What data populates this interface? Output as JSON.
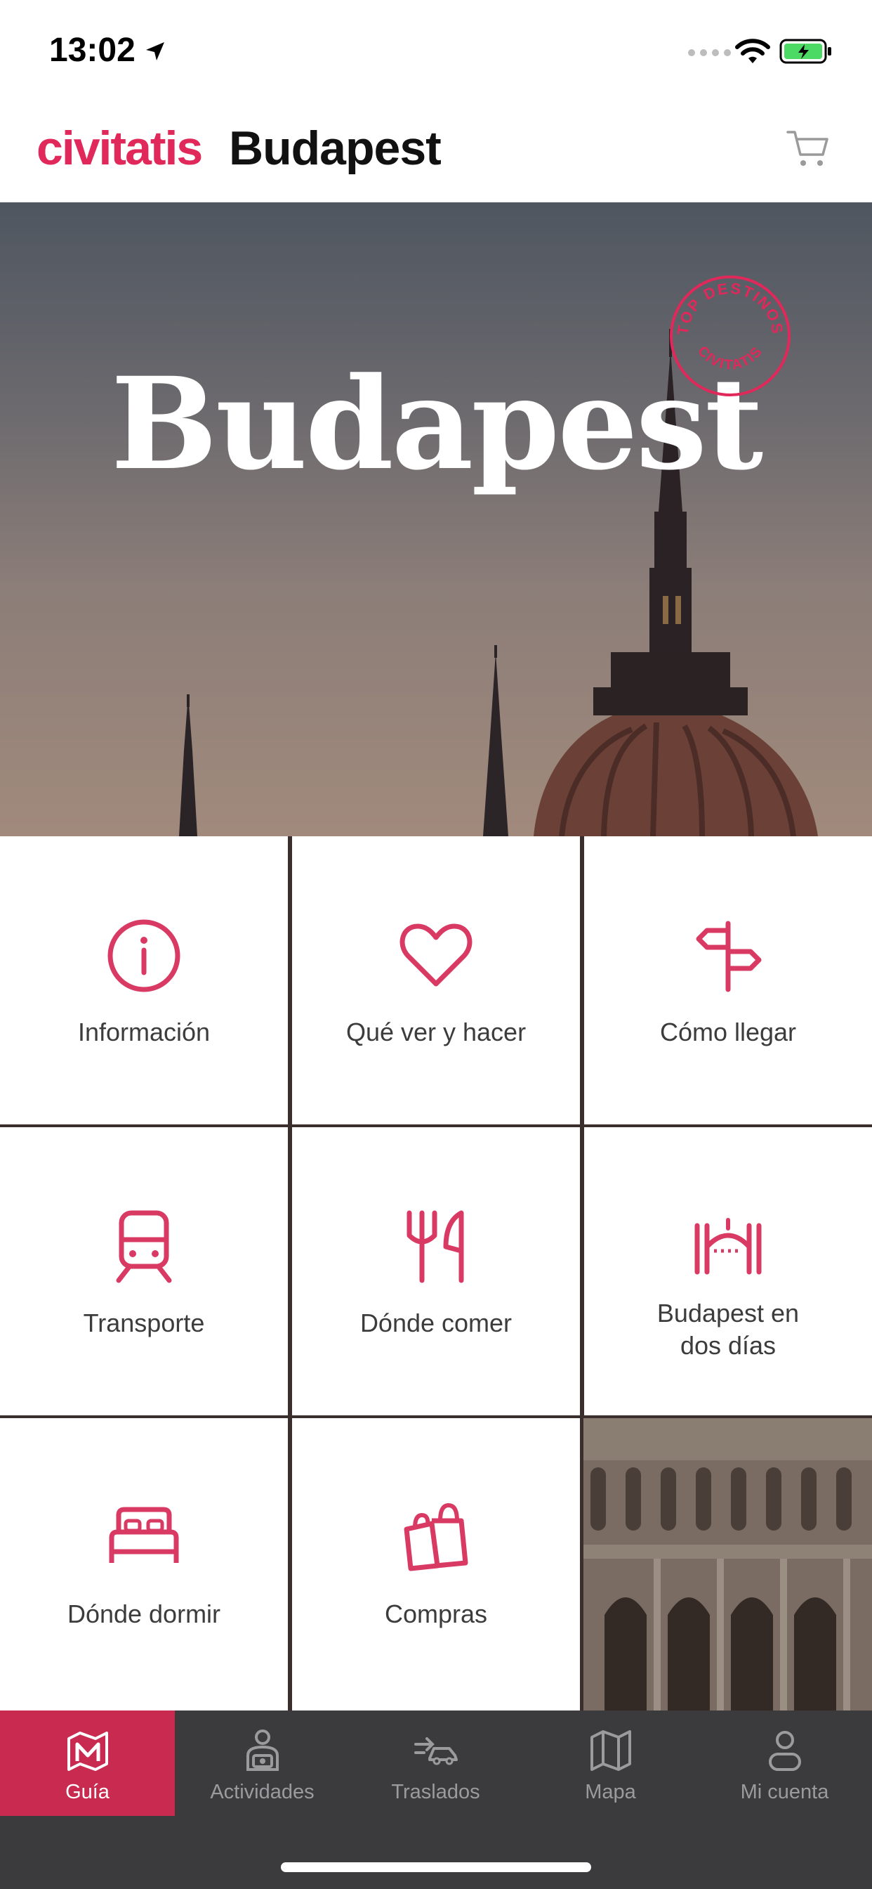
{
  "status_bar": {
    "time": "13:02"
  },
  "header": {
    "brand": "civitatis",
    "title": "Budapest"
  },
  "hero": {
    "title": "Budapest",
    "stamp_top": "TOP DESTINOS",
    "stamp_bottom": "CIVITATIS"
  },
  "grid": {
    "items": [
      {
        "label": "Información",
        "icon": "info-icon"
      },
      {
        "label": "Qué ver y hacer",
        "icon": "heart-icon"
      },
      {
        "label": "Cómo llegar",
        "icon": "signpost-icon"
      },
      {
        "label": "Transporte",
        "icon": "train-icon"
      },
      {
        "label": "Dónde comer",
        "icon": "fork-knife-icon"
      },
      {
        "label": "Budapest en dos días",
        "label_line1": "Budapest en",
        "label_line2": "dos días",
        "icon": "arch-icon"
      },
      {
        "label": "Dónde dormir",
        "icon": "bed-icon"
      },
      {
        "label": "Compras",
        "icon": "shopping-bags-icon"
      }
    ]
  },
  "tabbar": {
    "items": [
      {
        "label": "Guía",
        "icon": "map-guide-icon",
        "active": true
      },
      {
        "label": "Actividades",
        "icon": "person-camera-icon",
        "active": false
      },
      {
        "label": "Traslados",
        "icon": "car-arrow-icon",
        "active": false
      },
      {
        "label": "Mapa",
        "icon": "map-icon",
        "active": false
      },
      {
        "label": "Mi cuenta",
        "icon": "user-icon",
        "active": false
      }
    ]
  },
  "colors": {
    "brand": "#e0285a",
    "icon": "#d93a63",
    "tab_active": "#c82a50",
    "tab_bg": "#3b3b3d"
  }
}
